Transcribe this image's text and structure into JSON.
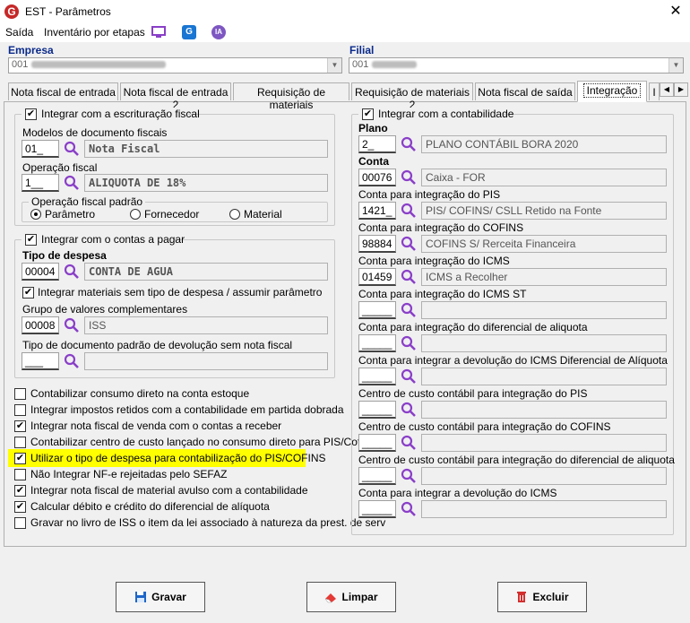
{
  "window": {
    "title": "EST - Parâmetros",
    "close_glyph": "✕"
  },
  "menu": {
    "items": [
      "Saída",
      "Inventário por etapas"
    ],
    "icon_g": "G",
    "icon_ia": "IA"
  },
  "header": {
    "empresa_label": "Empresa",
    "empresa_value": "001",
    "filial_label": "Filial",
    "filial_value": "001"
  },
  "tabs": [
    "Nota fiscal de entrada",
    "Nota fiscal de entrada 2",
    "Requisição de materiais",
    "Requisição de materiais 2",
    "Nota fiscal de saída",
    "Integração",
    "I"
  ],
  "left": {
    "fiscal": {
      "title": "Integrar com a escrituração fiscal",
      "checked": true,
      "modelos_label": "Modelos de documento fiscais",
      "modelos_code": "01_",
      "modelos_desc": "Nota Fiscal",
      "operacao_label": "Operação fiscal",
      "operacao_code": "1__",
      "operacao_desc": "ALIQUOTA DE 18%",
      "padrao_title": "Operação fiscal padrão",
      "radios": [
        "Parâmetro",
        "Fornecedor",
        "Material"
      ],
      "selected": 0
    },
    "pagar": {
      "title": "Integrar com o contas a pagar",
      "checked": true,
      "tipo_label": "Tipo de despesa",
      "tipo_code": "00004",
      "tipo_desc": "CONTA DE AGUA",
      "materiais_label": "Integrar materiais sem tipo de despesa / assumir parâmetro",
      "materiais_checked": true,
      "grupo_label": "Grupo de valores complementares",
      "grupo_code": "00008",
      "grupo_desc": "ISS",
      "devolucao_label": "Tipo de documento padrão de devolução sem nota fiscal",
      "devolucao_code": "___",
      "devolucao_desc": ""
    },
    "options": [
      {
        "label": "Contabilizar consumo direto na conta estoque",
        "checked": false
      },
      {
        "label": "Integrar impostos retidos com a contabilidade em partida dobrada",
        "checked": false
      },
      {
        "label": "Integrar nota fiscal de venda com o contas a receber",
        "checked": true
      },
      {
        "label": "Contabilizar centro de custo lançado no consumo direto para PIS/Cofins",
        "checked": false
      },
      {
        "label": "Utilizar o tipo de despesa para contabilização do PIS/COFINS",
        "checked": true,
        "highlight": true
      },
      {
        "label": "Não Integrar NF-e rejeitadas pelo SEFAZ",
        "checked": false
      },
      {
        "label": "Integrar nota fiscal de material avulso com a contabilidade",
        "checked": true
      },
      {
        "label": "Calcular débito e crédito do diferencial de alíquota",
        "checked": true
      },
      {
        "label": "Gravar no livro de ISS o item da lei associado à natureza da prest. de serv",
        "checked": false
      }
    ]
  },
  "right": {
    "title": "Integrar com a contabilidade",
    "checked": true,
    "fields": [
      {
        "label": "Plano",
        "bold": true,
        "code": "2_",
        "desc": "PLANO CONTÁBIL BORA 2020"
      },
      {
        "label": "Conta",
        "bold": true,
        "code": "00076",
        "desc": "Caixa - FOR"
      },
      {
        "label": "Conta para integração do PIS",
        "code": "1421_",
        "desc": "PIS/ COFINS/ CSLL Retido na Fonte"
      },
      {
        "label": "Conta para integração do COFINS",
        "code": "98884",
        "desc": "COFINS S/ Rerceita Financeira"
      },
      {
        "label": "Conta para integração do ICMS",
        "code": "01459",
        "desc": "ICMS a Recolher"
      },
      {
        "label": "Conta para integração do ICMS ST",
        "code": "_____",
        "desc": ""
      },
      {
        "label": "Conta para integração do diferencial de aliquota",
        "code": "_____",
        "desc": ""
      },
      {
        "label": "Conta para integrar a devolução do ICMS Diferencial de Alíquota",
        "code": "_____",
        "desc": ""
      },
      {
        "label": "Centro de custo contábil para integração do PIS",
        "code": "_____",
        "desc": ""
      },
      {
        "label": "Centro de custo contábil para integração do COFINS",
        "code": "_____",
        "desc": ""
      },
      {
        "label": "Centro de custo contábil para integração do diferencial de aliquota",
        "code": "_____",
        "desc": ""
      },
      {
        "label": "Conta para integrar a devolução do ICMS",
        "code": "_____",
        "desc": ""
      }
    ]
  },
  "buttons": {
    "save": "Gravar",
    "clear": "Limpar",
    "delete": "Excluir"
  },
  "colors": {
    "accent": "#0a2a8a",
    "search_icon": "#8a3fc8",
    "highlight": "#ffff00"
  }
}
